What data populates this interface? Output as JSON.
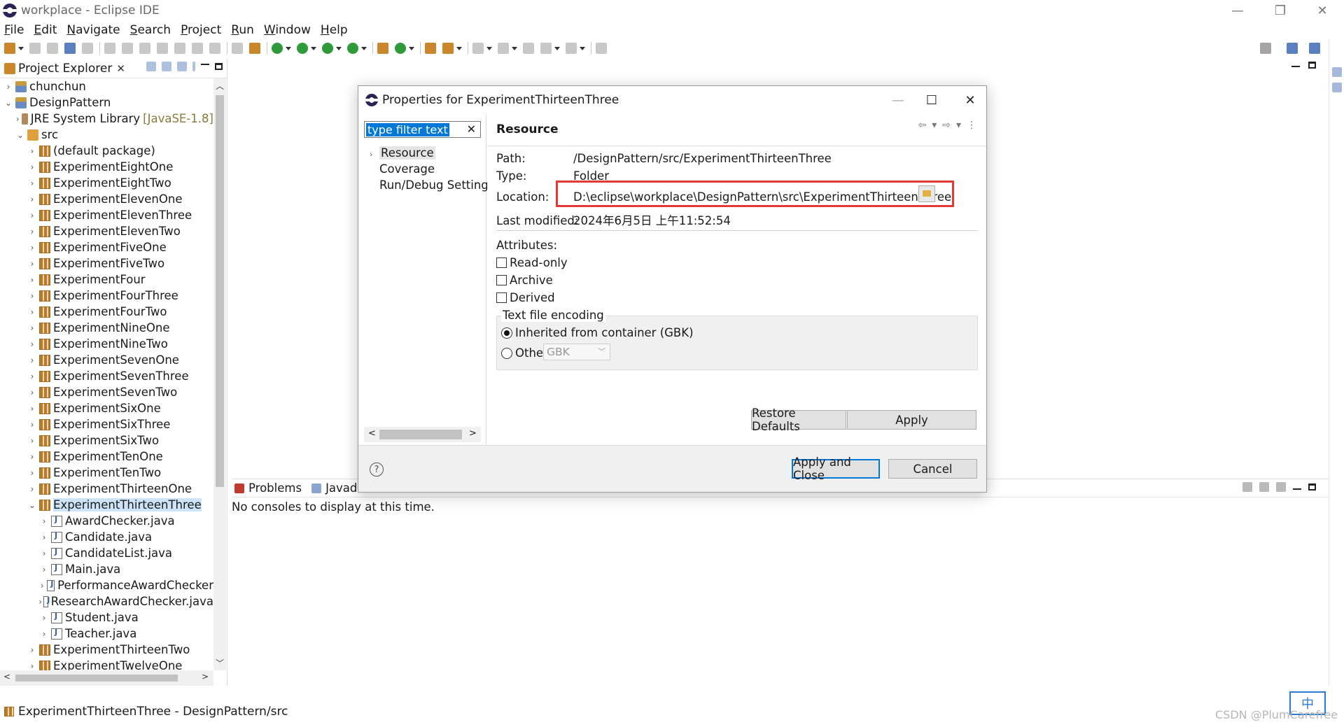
{
  "window": {
    "title": "workplace - Eclipse IDE",
    "controls": {
      "minimize": "—",
      "restore": "❐",
      "close": "✕"
    }
  },
  "menu": [
    "File",
    "Edit",
    "Navigate",
    "Search",
    "Project",
    "Run",
    "Window",
    "Help"
  ],
  "project_explorer": {
    "tab_title": "Project Explorer",
    "close": "✕",
    "tree": [
      {
        "level": 0,
        "twisty": "›",
        "icon": "project-icon",
        "label": "chunchun"
      },
      {
        "level": 0,
        "twisty": "⌄",
        "icon": "project-icon",
        "label": "DesignPattern"
      },
      {
        "level": 1,
        "twisty": "›",
        "icon": "library-icon",
        "label": "JRE System Library",
        "deco": "[JavaSE-1.8]"
      },
      {
        "level": 1,
        "twisty": "⌄",
        "icon": "source-folder-icon",
        "label": "src"
      },
      {
        "level": 2,
        "twisty": "›",
        "icon": "package-icon",
        "label": "(default package)"
      },
      {
        "level": 2,
        "twisty": "›",
        "icon": "package-icon",
        "label": "ExperimentEightOne"
      },
      {
        "level": 2,
        "twisty": "›",
        "icon": "package-icon",
        "label": "ExperimentEightTwo"
      },
      {
        "level": 2,
        "twisty": "›",
        "icon": "package-icon",
        "label": "ExperimentElevenOne"
      },
      {
        "level": 2,
        "twisty": "›",
        "icon": "package-icon",
        "label": "ExperimentElevenThree"
      },
      {
        "level": 2,
        "twisty": "›",
        "icon": "package-icon",
        "label": "ExperimentElevenTwo"
      },
      {
        "level": 2,
        "twisty": "›",
        "icon": "package-icon",
        "label": "ExperimentFiveOne"
      },
      {
        "level": 2,
        "twisty": "›",
        "icon": "package-icon",
        "label": "ExperimentFiveTwo"
      },
      {
        "level": 2,
        "twisty": "›",
        "icon": "package-icon",
        "label": "ExperimentFour"
      },
      {
        "level": 2,
        "twisty": "›",
        "icon": "package-icon",
        "label": "ExperimentFourThree"
      },
      {
        "level": 2,
        "twisty": "›",
        "icon": "package-icon",
        "label": "ExperimentFourTwo"
      },
      {
        "level": 2,
        "twisty": "›",
        "icon": "package-icon",
        "label": "ExperimentNineOne"
      },
      {
        "level": 2,
        "twisty": "›",
        "icon": "package-icon",
        "label": "ExperimentNineTwo"
      },
      {
        "level": 2,
        "twisty": "›",
        "icon": "package-icon",
        "label": "ExperimentSevenOne"
      },
      {
        "level": 2,
        "twisty": "›",
        "icon": "package-icon",
        "label": "ExperimentSevenThree"
      },
      {
        "level": 2,
        "twisty": "›",
        "icon": "package-icon",
        "label": "ExperimentSevenTwo"
      },
      {
        "level": 2,
        "twisty": "›",
        "icon": "package-icon",
        "label": "ExperimentSixOne"
      },
      {
        "level": 2,
        "twisty": "›",
        "icon": "package-icon",
        "label": "ExperimentSixThree"
      },
      {
        "level": 2,
        "twisty": "›",
        "icon": "package-icon",
        "label": "ExperimentSixTwo"
      },
      {
        "level": 2,
        "twisty": "›",
        "icon": "package-icon",
        "label": "ExperimentTenOne"
      },
      {
        "level": 2,
        "twisty": "›",
        "icon": "package-icon",
        "label": "ExperimentTenTwo"
      },
      {
        "level": 2,
        "twisty": "›",
        "icon": "package-icon",
        "label": "ExperimentThirteenOne"
      },
      {
        "level": 2,
        "twisty": "⌄",
        "icon": "package-icon",
        "label": "ExperimentThirteenThree",
        "selected": true
      },
      {
        "level": 3,
        "twisty": "›",
        "icon": "java-file-icon",
        "label": "AwardChecker.java"
      },
      {
        "level": 3,
        "twisty": "›",
        "icon": "java-file-icon",
        "label": "Candidate.java"
      },
      {
        "level": 3,
        "twisty": "›",
        "icon": "java-file-icon",
        "label": "CandidateList.java"
      },
      {
        "level": 3,
        "twisty": "›",
        "icon": "java-file-icon",
        "label": "Main.java"
      },
      {
        "level": 3,
        "twisty": "›",
        "icon": "java-file-icon",
        "label": "PerformanceAwardChecker"
      },
      {
        "level": 3,
        "twisty": "›",
        "icon": "java-file-icon",
        "label": "ResearchAwardChecker.java"
      },
      {
        "level": 3,
        "twisty": "›",
        "icon": "java-file-icon",
        "label": "Student.java"
      },
      {
        "level": 3,
        "twisty": "›",
        "icon": "java-file-icon",
        "label": "Teacher.java"
      },
      {
        "level": 2,
        "twisty": "›",
        "icon": "package-icon",
        "label": "ExperimentThirteenTwo"
      },
      {
        "level": 2,
        "twisty": "›",
        "icon": "package-icon",
        "label": "ExperimentTwelveOne"
      },
      {
        "level": 2,
        "twisty": "›",
        "icon": "package-icon",
        "label": "ExperimentTwelveTwo"
      }
    ]
  },
  "console": {
    "tabs": [
      {
        "label": "Problems",
        "icon": "problems-icon"
      },
      {
        "label": "Javadoc",
        "icon": "javadoc-icon"
      }
    ],
    "message": "No consoles to display at this time."
  },
  "statusbar": {
    "text": "ExperimentThirteenThree - DesignPattern/src"
  },
  "ime_indicator": "中",
  "watermark": "CSDN @PlumCarefree",
  "dialog": {
    "title": "Properties for ExperimentThirteenThree",
    "filter_placeholder": "type filter text",
    "nav": [
      {
        "label": "Resource",
        "twisty": "›",
        "selected": true
      },
      {
        "label": "Coverage",
        "twisty": ""
      },
      {
        "label": "Run/Debug Setting",
        "twisty": ""
      }
    ],
    "page_title": "Resource",
    "path_label": "Path:",
    "path_value": "/DesignPattern/src/ExperimentThirteenThree",
    "type_label": "Type:",
    "type_value": "Folder",
    "location_label": "Location:",
    "location_value": "D:\\eclipse\\workplace\\DesignPattern\\src\\ExperimentThirteenThree",
    "modified_label": "Last modified:",
    "modified_value": "2024年6月5日 上午11:52:54",
    "attributes_label": "Attributes:",
    "attributes": [
      {
        "label": "Read-only",
        "checked": false
      },
      {
        "label": "Archive",
        "checked": false
      },
      {
        "label": "Derived",
        "checked": false
      }
    ],
    "encoding": {
      "group_title": "Text file encoding",
      "inherited_label": "Inherited from container (GBK)",
      "inherited_selected": true,
      "other_label": "Other:",
      "other_value": "GBK"
    },
    "buttons": {
      "restore_defaults": "Restore Defaults",
      "apply": "Apply",
      "apply_and_close": "Apply and Close",
      "cancel": "Cancel"
    },
    "help": "?"
  },
  "colors": {
    "selection": "#cde3f7",
    "highlight_box": "#e53935",
    "accent": "#0078d7"
  }
}
